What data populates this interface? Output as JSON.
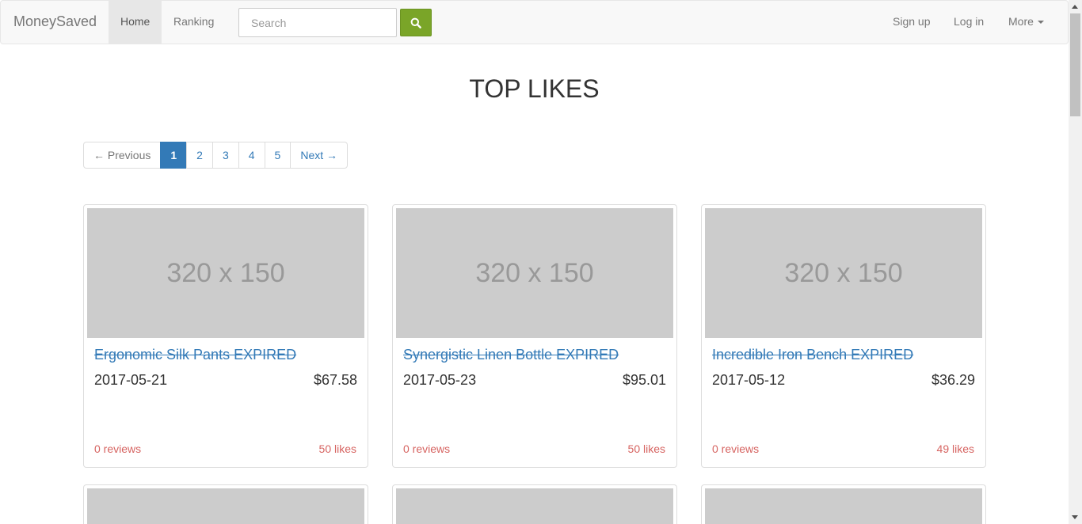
{
  "nav": {
    "brand": "MoneySaved",
    "home": "Home",
    "ranking": "Ranking",
    "search_placeholder": "Search",
    "signup": "Sign up",
    "login": "Log in",
    "more": "More",
    "search_button_color": "#7aa528"
  },
  "page": {
    "title": "TOP LIKES"
  },
  "pagination": {
    "previous": "← Previous",
    "pages": [
      "1",
      "2",
      "3",
      "4",
      "5"
    ],
    "active_page": "1",
    "next": "Next →"
  },
  "cards": [
    {
      "image_label": "320 x 150",
      "title": "Ergonomic Silk Pants EXPIRED",
      "date": "2017-05-21",
      "price": "$67.58",
      "reviews": "0 reviews",
      "likes": "50 likes"
    },
    {
      "image_label": "320 x 150",
      "title": "Synergistic Linen Bottle EXPIRED",
      "date": "2017-05-23",
      "price": "$95.01",
      "reviews": "0 reviews",
      "likes": "50 likes"
    },
    {
      "image_label": "320 x 150",
      "title": "Incredible Iron Bench EXPIRED",
      "date": "2017-05-12",
      "price": "$36.29",
      "reviews": "0 reviews",
      "likes": "49 likes"
    }
  ]
}
